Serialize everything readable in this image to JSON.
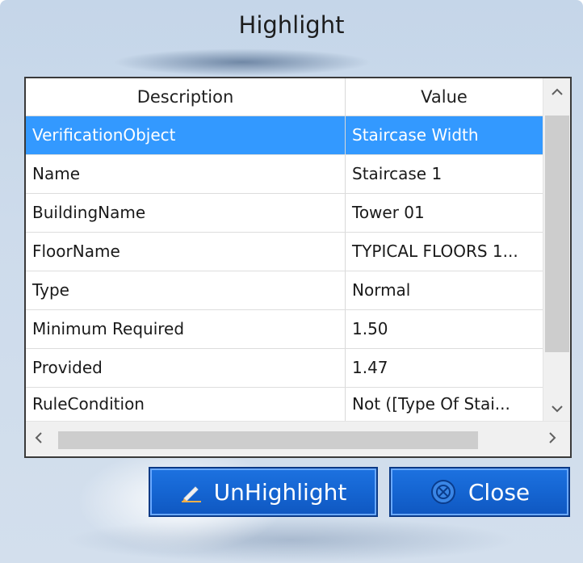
{
  "dialog": {
    "title": "Highlight"
  },
  "table": {
    "headers": {
      "description": "Description",
      "value": "Value"
    },
    "rows": [
      {
        "description": "VerificationObject",
        "value": "Staircase Width"
      },
      {
        "description": "Name",
        "value": "Staircase 1"
      },
      {
        "description": "BuildingName",
        "value": "Tower 01"
      },
      {
        "description": "FloorName",
        "value": "TYPICAL FLOORS 1..."
      },
      {
        "description": "Type",
        "value": "Normal"
      },
      {
        "description": "Minimum Required",
        "value": "1.50"
      },
      {
        "description": "Provided",
        "value": "1.47"
      },
      {
        "description": "RuleCondition",
        "value": "Not ([Type Of Stai..."
      }
    ],
    "selected_row_index": 0
  },
  "scrollbars": {
    "up_arrow": "^",
    "down_arrow": "v",
    "left_arrow": "<",
    "right_arrow": ">"
  },
  "buttons": {
    "unhighlight_label": "UnHighlight",
    "close_label": "Close"
  },
  "colors": {
    "selection": "#3399ff",
    "button": "#1565d2",
    "dialog_bg": "#cddbeb"
  },
  "icons": {
    "unhighlight": "pencil-icon",
    "close": "circle-icon"
  }
}
